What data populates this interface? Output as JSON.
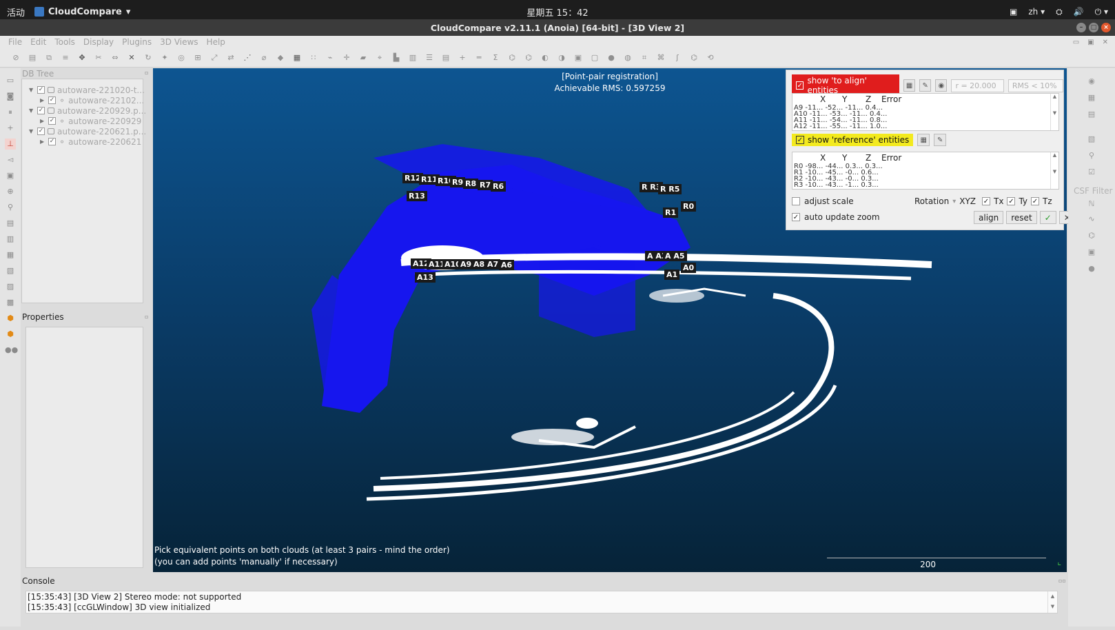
{
  "gnome": {
    "activities": "活动",
    "app_name": "CloudCompare",
    "app_menu_arrow": "▾",
    "clock": "星期五 15：42",
    "lang": "zh ▾",
    "icons": [
      "display-icon",
      "network-icon",
      "volume-icon",
      "power-icon"
    ]
  },
  "window": {
    "title": "CloudCompare v2.11.1 (Anoia) [64-bit] - [3D View 2]",
    "buttons": [
      "minimize",
      "maximize",
      "close"
    ]
  },
  "menu": [
    "File",
    "Edit",
    "Tools",
    "Display",
    "Plugins",
    "3D Views",
    "Help"
  ],
  "dbtree": {
    "title": "DB Tree",
    "items": [
      {
        "label": "autoware-221020-t...",
        "level": 0,
        "expanded": true,
        "checked": true
      },
      {
        "label": "autoware-22102...",
        "level": 1,
        "expanded": false,
        "checked": true
      },
      {
        "label": "autoware-220929.p...",
        "level": 0,
        "expanded": true,
        "checked": true
      },
      {
        "label": "autoware-220929",
        "level": 1,
        "expanded": false,
        "checked": true
      },
      {
        "label": "autoware-220621.p...",
        "level": 0,
        "expanded": true,
        "checked": true
      },
      {
        "label": "autoware-220621",
        "level": 1,
        "expanded": false,
        "checked": true
      }
    ]
  },
  "properties": {
    "title": "Properties"
  },
  "view": {
    "header_line1": "[Point-pair registration]",
    "header_line2": "Achievable RMS: 0.597259",
    "footer_line1": "Pick equivalent points on both clouds (at least 3 pairs - mind the order)",
    "footer_line2": "(you can add points 'manually' if necessary)",
    "scale_label": "200",
    "reference_points": [
      "R12",
      "R11",
      "R10",
      "R9",
      "R8",
      "R7",
      "R6",
      "R13",
      "R R3",
      "R R5",
      "R1",
      "R0"
    ],
    "aligned_points": [
      "A12",
      "A11",
      "A10",
      "A9",
      "A8",
      "A7",
      "A6",
      "A13",
      "A A3",
      "A A5",
      "A0",
      "A1"
    ]
  },
  "registration": {
    "show_to_align": "show 'to align' entities",
    "show_reference": "show 'reference' entities",
    "radius_field": "r = 20.000",
    "rms_field": "RMS < 10%",
    "table_headers": [
      "X",
      "Y",
      "Z",
      "Error"
    ],
    "align_rows": [
      [
        "A9",
        "-11...",
        "-52...",
        "-11...",
        "0.4..."
      ],
      [
        "A10",
        "-11...",
        "-53...",
        "-11...",
        "0.4..."
      ],
      [
        "A11",
        "-11...",
        "-54...",
        "-11...",
        "0.8..."
      ],
      [
        "A12",
        "-11...",
        "-55...",
        "-11...",
        "1.0..."
      ]
    ],
    "reference_rows": [
      [
        "R0",
        "-98...",
        "-44...",
        "0.3...",
        "0.3..."
      ],
      [
        "R1",
        "-10...",
        "-45...",
        "-0...",
        "0.6..."
      ],
      [
        "R2",
        "-10...",
        "-43...",
        "-0...",
        "0.3..."
      ],
      [
        "R3",
        "-10...",
        "-43...",
        "-1...",
        "0.3..."
      ]
    ],
    "adjust_scale": "adjust scale",
    "adjust_scale_checked": false,
    "rotation_label": "Rotation",
    "rotation_value": "XYZ",
    "tx": "Tx",
    "ty": "Ty",
    "tz": "Tz",
    "auto_update_zoom": "auto update zoom",
    "auto_update_zoom_checked": true,
    "align_button": "align",
    "reset_button": "reset",
    "accent_red": "#e01d1d",
    "accent_yellow": "#f3ea1e"
  },
  "right_panel": {
    "csf_label": "CSF Filter"
  },
  "console": {
    "title": "Console",
    "lines": [
      "[15:35:43] [3D View 2] Stereo mode: not supported",
      "[15:35:43] [ccGLWindow] 3D view initialized"
    ]
  }
}
